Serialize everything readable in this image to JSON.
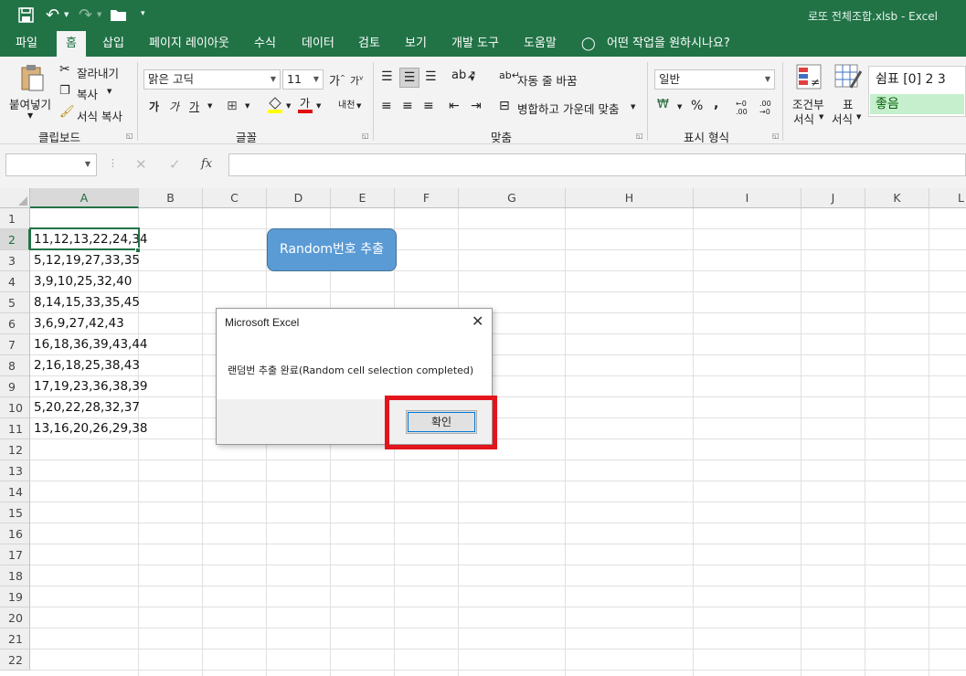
{
  "titlebar": {
    "title": "로또 전체조합.xlsb  -  Excel"
  },
  "tabs": [
    "파일",
    "홈",
    "삽입",
    "페이지 레이아웃",
    "수식",
    "데이터",
    "검토",
    "보기",
    "개발 도구",
    "도움말"
  ],
  "tell_me": "어떤 작업을 원하시나요?",
  "ribbon": {
    "clipboard": {
      "paste": "붙여넣기",
      "cut": "잘라내기",
      "copy": "복사",
      "format_painter": "서식 복사",
      "group_label": "클립보드"
    },
    "font": {
      "font_name": "맑은 고딕",
      "font_size": "11",
      "group_label": "글꼴"
    },
    "alignment": {
      "wrap_text": "자동 줄 바꿈",
      "merge_center": "병합하고 가운데 맞춤",
      "group_label": "맞춤"
    },
    "number": {
      "format": "일반",
      "group_label": "표시 형식"
    },
    "styles": {
      "conditional_line1": "조건부",
      "conditional_line2": "서식",
      "table_line1": "표",
      "table_line2": "서식",
      "style_normal": "쉼표 [0] 2 3",
      "style_good": "좋음"
    }
  },
  "formula_bar": {
    "fx": "fx"
  },
  "columns": [
    "A",
    "B",
    "C",
    "D",
    "E",
    "F",
    "G",
    "H",
    "I",
    "J",
    "K",
    "L"
  ],
  "rows": [
    "1",
    "2",
    "3",
    "4",
    "5",
    "6",
    "7",
    "8",
    "9",
    "10",
    "11",
    "12",
    "13",
    "14",
    "15",
    "16",
    "17",
    "18",
    "19",
    "20",
    "21",
    "22"
  ],
  "cells_A": [
    "11,12,13,22,24,34",
    "5,12,19,27,33,35",
    "3,9,10,25,32,40",
    "8,14,15,33,35,45",
    "3,6,9,27,42,43",
    "16,18,36,39,43,44",
    "2,16,18,25,38,43",
    "17,19,23,36,38,39",
    "5,20,22,28,32,37",
    "13,16,20,26,29,38"
  ],
  "macro_button": "Random번호 추출",
  "dialog": {
    "title": "Microsoft Excel",
    "message": "랜덤번 추출 완료(Random cell selection completed)",
    "ok": "확인"
  },
  "colors": {
    "excel_green": "#217346",
    "macro_blue": "#5b9bd5",
    "highlight_red": "#e3141b"
  }
}
